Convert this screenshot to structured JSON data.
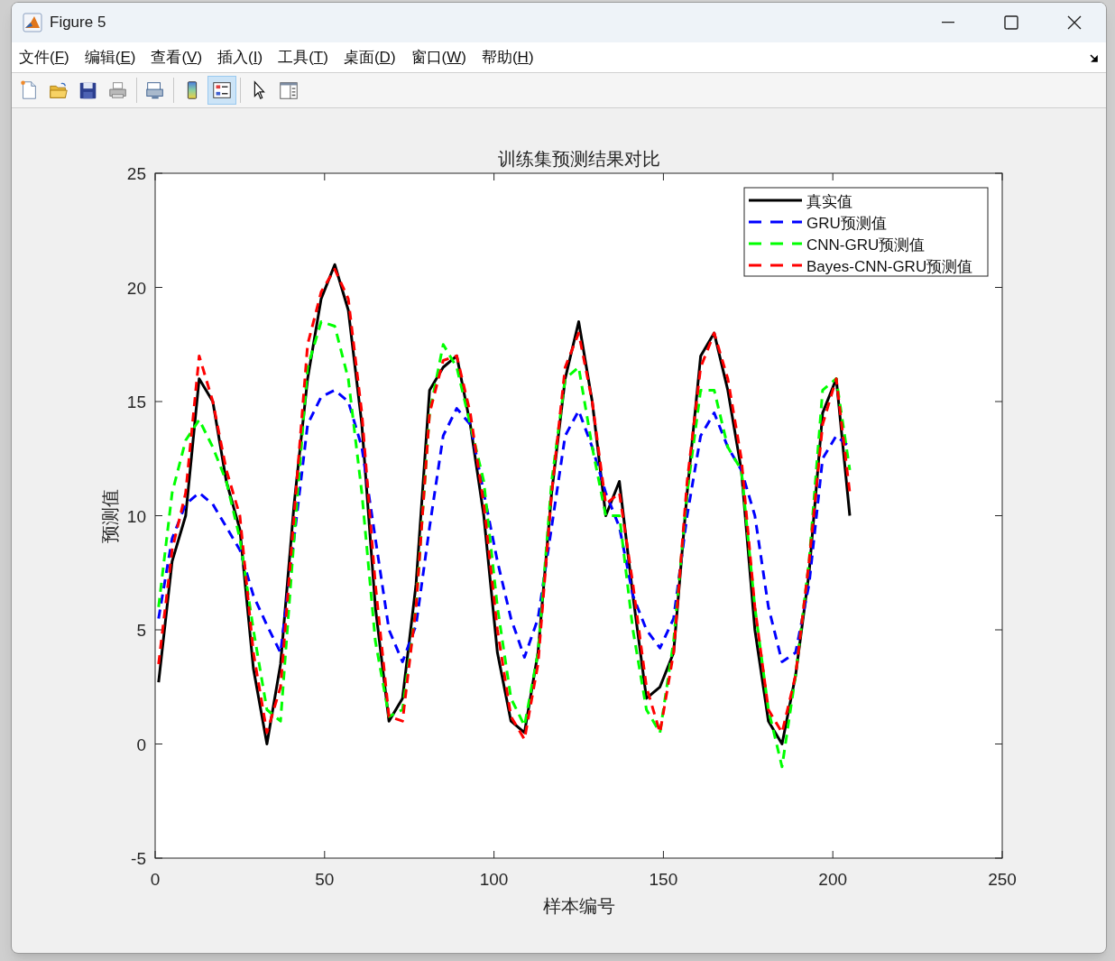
{
  "window": {
    "title": "Figure 5"
  },
  "menu": [
    "文件(F)",
    "编辑(E)",
    "查看(V)",
    "插入(I)",
    "工具(T)",
    "桌面(D)",
    "窗口(W)",
    "帮助(H)"
  ],
  "toolbar": [
    {
      "kind": "new",
      "selected": false
    },
    {
      "kind": "open",
      "selected": false
    },
    {
      "kind": "save",
      "selected": false
    },
    {
      "kind": "print",
      "selected": false
    },
    {
      "kind": "link",
      "selected": false
    },
    {
      "kind": "colorbar",
      "selected": false
    },
    {
      "kind": "legend",
      "selected": true
    },
    {
      "kind": "pointer",
      "selected": false
    },
    {
      "kind": "inspector",
      "selected": false
    }
  ],
  "chart_data": {
    "type": "line",
    "title": "训练集预测结果对比",
    "xlabel": "样本编号",
    "ylabel": "预测值",
    "xlim": [
      0,
      250
    ],
    "ylim": [
      -5,
      25
    ],
    "xticks": [
      0,
      50,
      100,
      150,
      200,
      250
    ],
    "yticks": [
      -5,
      0,
      5,
      10,
      15,
      20,
      25
    ],
    "legend": true,
    "x": [
      1,
      5,
      9,
      13,
      17,
      21,
      25,
      29,
      33,
      37,
      41,
      45,
      49,
      53,
      57,
      61,
      65,
      69,
      73,
      77,
      81,
      85,
      89,
      93,
      97,
      101,
      105,
      109,
      113,
      117,
      121,
      125,
      129,
      133,
      137,
      141,
      145,
      149,
      153,
      157,
      161,
      165,
      169,
      173,
      177,
      181,
      185,
      189,
      193,
      197,
      201,
      205
    ],
    "series": [
      {
        "name": "真实值",
        "color": "#000000",
        "line_style": "solid",
        "values": [
          2.7,
          8,
          10,
          16,
          15,
          11.5,
          9.4,
          3.3,
          0,
          3.5,
          10.5,
          16,
          19.5,
          21,
          19,
          14,
          6,
          1,
          2,
          7,
          15.5,
          16.5,
          17,
          14,
          10,
          4,
          1,
          0.5,
          4,
          11,
          16,
          18.5,
          15,
          10,
          11.5,
          6.5,
          2,
          2.5,
          4,
          11,
          17,
          18,
          15.5,
          12,
          5,
          1,
          0,
          3,
          7.5,
          14.5,
          16,
          10
        ]
      },
      {
        "name": "GRU预测值",
        "color": "#0000ff",
        "line_style": "dashed",
        "values": [
          5.5,
          9,
          10.5,
          11,
          10.5,
          9.5,
          8.5,
          6.5,
          5.2,
          4,
          9,
          14,
          15.2,
          15.5,
          15,
          13,
          9,
          5,
          3.6,
          5.2,
          9.5,
          13.5,
          14.7,
          14,
          11,
          8,
          5.5,
          3.8,
          5.5,
          9.5,
          13.5,
          14.6,
          13,
          11,
          9.5,
          6.5,
          5,
          4.2,
          5.5,
          10,
          13.5,
          14.5,
          13,
          12,
          10,
          6,
          3.6,
          4,
          7,
          12.5,
          13.5,
          13
        ]
      },
      {
        "name": "CNN-GRU预测值",
        "color": "#00ff00",
        "line_style": "dashed",
        "values": [
          6,
          11,
          13.3,
          14.2,
          13,
          11.5,
          9,
          5,
          1.5,
          1,
          9,
          16.5,
          18.5,
          18.3,
          16,
          11,
          4.5,
          1.2,
          1.5,
          6,
          14.5,
          17.5,
          16.5,
          14,
          11.5,
          6,
          2,
          0.8,
          4,
          11.5,
          16,
          16.5,
          13,
          10,
          10,
          5,
          1.5,
          0.5,
          4.5,
          11,
          15.5,
          15.5,
          13,
          12,
          6,
          1.5,
          -1,
          3,
          8,
          15.5,
          16,
          12
        ]
      },
      {
        "name": "Bayes-CNN-GRU预测值",
        "color": "#ff0000",
        "line_style": "dashed",
        "values": [
          3.5,
          8.5,
          11,
          17,
          15,
          12,
          10,
          4,
          0.5,
          2.5,
          10,
          17.5,
          19.8,
          20.8,
          19.5,
          14.5,
          7,
          1.2,
          1,
          6,
          14.5,
          16.8,
          17,
          14.5,
          10.5,
          5,
          1.2,
          0.2,
          3.5,
          11,
          16.5,
          18,
          15,
          10.5,
          11,
          7,
          2.5,
          0.5,
          4,
          11.5,
          16.5,
          18,
          16,
          12.5,
          6,
          1.5,
          0.5,
          3,
          8,
          14,
          16,
          11
        ]
      }
    ]
  }
}
